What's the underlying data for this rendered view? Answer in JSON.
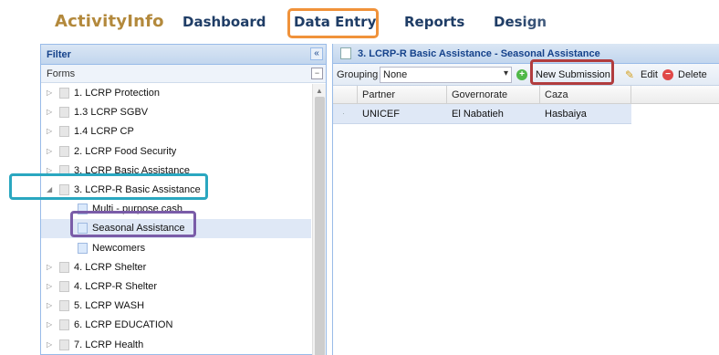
{
  "app": {
    "logo": "ActivityInfo",
    "nav": [
      "Dashboard",
      "Data Entry",
      "Reports",
      "Design"
    ]
  },
  "left_panel": {
    "header": "Filter",
    "collapse_label": "«",
    "forms_label": "Forms",
    "forms_toggle": "−",
    "tree": [
      {
        "label": "1. LCRP Protection",
        "level": 0,
        "expanded": false
      },
      {
        "label": "1.3 LCRP SGBV",
        "level": 0,
        "expanded": false
      },
      {
        "label": "1.4 LCRP CP",
        "level": 0,
        "expanded": false
      },
      {
        "label": "2. LCRP Food Security",
        "level": 0,
        "expanded": false
      },
      {
        "label": "3. LCRP Basic Assistance",
        "level": 0,
        "expanded": false
      },
      {
        "label": "3. LCRP-R Basic Assistance",
        "level": 0,
        "expanded": true
      },
      {
        "label": "Multi - purpose cash",
        "level": 1
      },
      {
        "label": "Seasonal Assistance",
        "level": 1,
        "selected": true
      },
      {
        "label": "Newcomers",
        "level": 1
      },
      {
        "label": "4. LCRP Shelter",
        "level": 0,
        "expanded": false
      },
      {
        "label": "4. LCRP-R Shelter",
        "level": 0,
        "expanded": false
      },
      {
        "label": "5. LCRP WASH",
        "level": 0,
        "expanded": false
      },
      {
        "label": "6. LCRP EDUCATION",
        "level": 0,
        "expanded": false
      },
      {
        "label": "7. LCRP Health",
        "level": 0,
        "expanded": false
      }
    ]
  },
  "right_panel": {
    "title": "3. LCRP-R Basic Assistance - Seasonal Assistance",
    "toolbar": {
      "grouping_label": "Grouping",
      "grouping_value": "None",
      "new_submission": "New Submission",
      "edit": "Edit",
      "delete": "Delete"
    },
    "columns": [
      "Partner",
      "Governorate",
      "Caza"
    ],
    "rows": [
      {
        "partner": "UNICEF",
        "governorate": "El Nabatieh",
        "caza": "Hasbaiya"
      }
    ]
  },
  "annotation_colors": {
    "data_entry": "#f0923a",
    "basic_assistance": "#2aa7c0",
    "seasonal": "#7a5ca8",
    "new_submission": "#b13c3e"
  }
}
